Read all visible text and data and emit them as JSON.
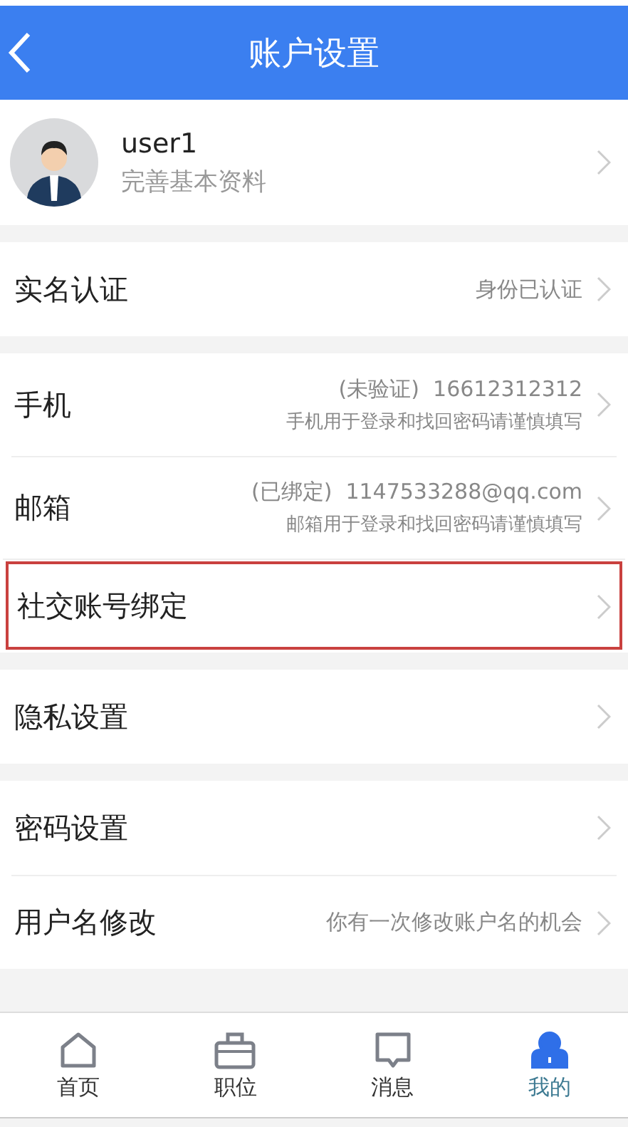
{
  "header": {
    "title": "账户设置"
  },
  "profile": {
    "name": "user1",
    "subtitle": "完善基本资料"
  },
  "groups": [
    {
      "rows": [
        {
          "label": "实名认证",
          "value": "身份已认证",
          "highlighted": false
        }
      ]
    },
    {
      "rows": [
        {
          "label": "手机",
          "value": "(未验证)  16612312312",
          "note": "手机用于登录和找回密码请谨慎填写",
          "highlighted": false
        },
        {
          "label": "邮箱",
          "value": "(已绑定)  1147533288@qq.com",
          "note": "邮箱用于登录和找回密码请谨慎填写",
          "highlighted": false
        },
        {
          "label": "社交账号绑定",
          "highlighted": true
        }
      ]
    },
    {
      "rows": [
        {
          "label": "隐私设置",
          "highlighted": false
        }
      ]
    },
    {
      "rows": [
        {
          "label": "密码设置",
          "highlighted": false
        },
        {
          "label": "用户名修改",
          "value": "你有一次修改账户名的机会",
          "highlighted": false
        }
      ]
    }
  ],
  "tabs": [
    {
      "label": "首页",
      "kind": "home",
      "selected": false
    },
    {
      "label": "职位",
      "kind": "briefcase",
      "selected": false
    },
    {
      "label": "消息",
      "kind": "message",
      "selected": false
    },
    {
      "label": "我的",
      "kind": "person",
      "selected": true
    }
  ]
}
